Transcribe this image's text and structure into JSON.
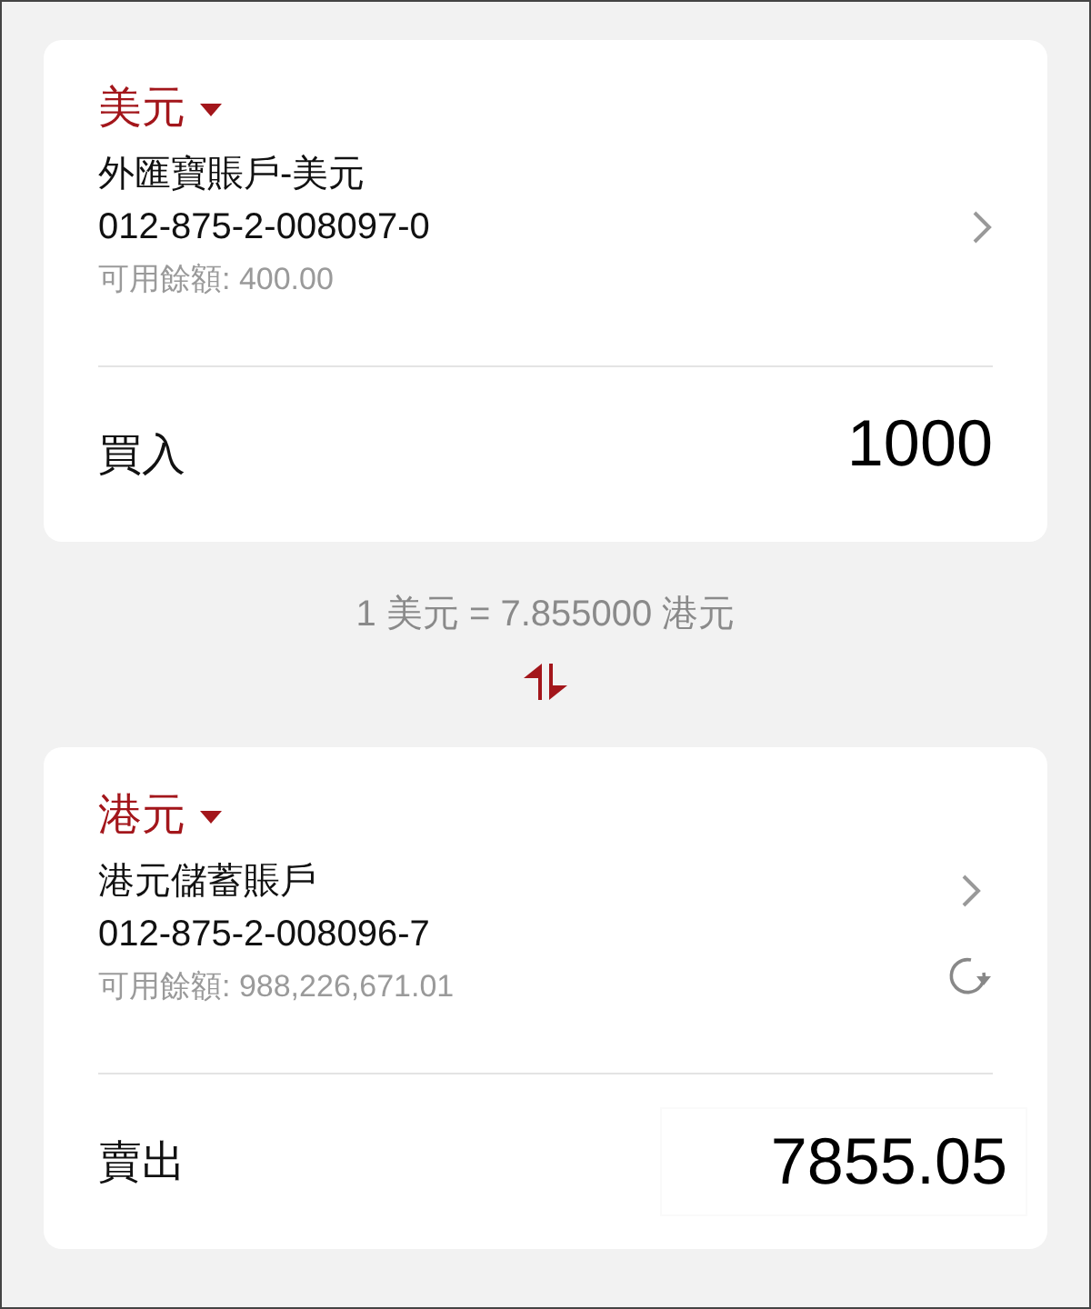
{
  "accounts": [
    {
      "currency": "美元",
      "name": "外匯寶賬戶-美元",
      "number": "012-875-2-008097-0",
      "balance": "可用餘額: 400.00",
      "refresh": false,
      "action": "買入",
      "amount": "1000",
      "kind": "display"
    },
    {
      "currency": "港元",
      "name": "港元儲蓄賬戶",
      "number": "012-875-2-008096-7",
      "balance": "可用餘額: 988,226,671.01",
      "refresh": true,
      "action": "賣出",
      "amount": "7855.05",
      "kind": "field"
    }
  ],
  "rate": "1 美元 = 7.855000 港元"
}
